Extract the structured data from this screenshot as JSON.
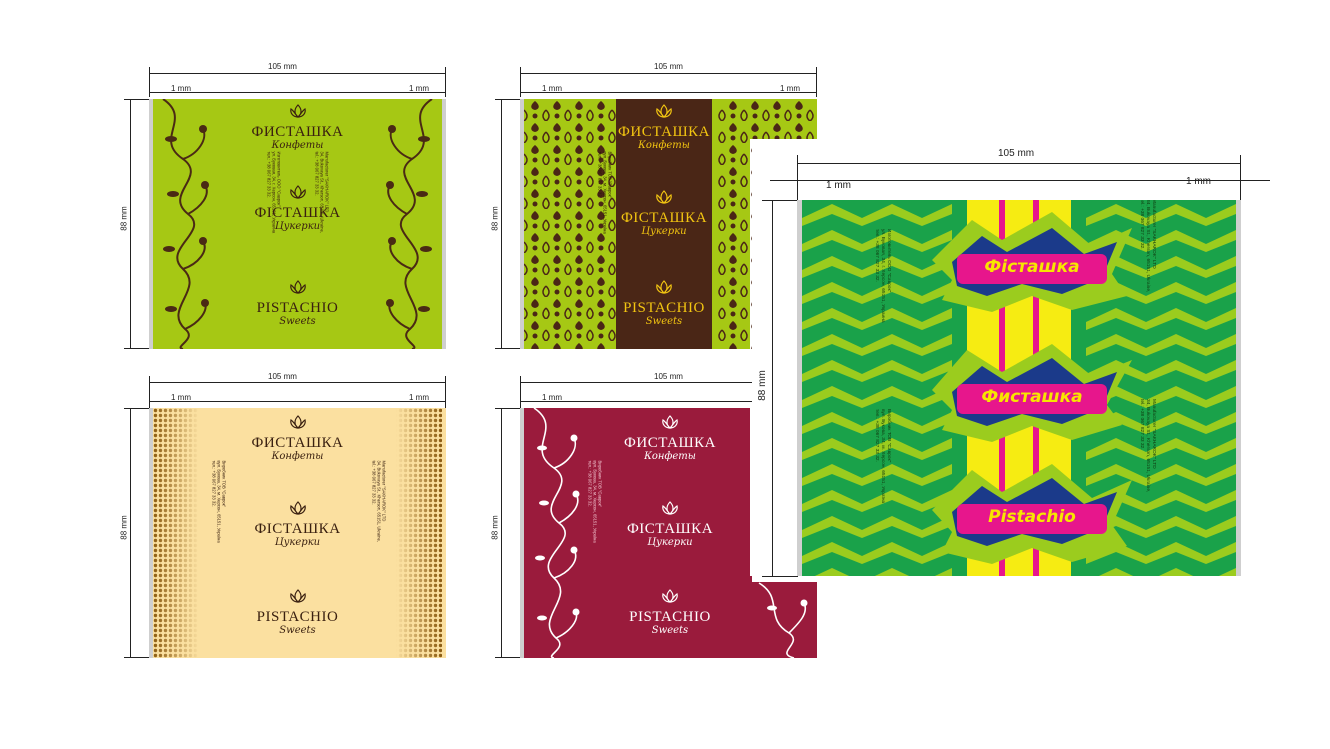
{
  "dimensions": {
    "width_label": "105 mm",
    "height_label": "88 mm",
    "margin_left_label": "1 mm",
    "margin_right_label": "1 mm"
  },
  "brand": {
    "line1_ru": "ФИСТАШКА",
    "line1_ru_sub": "Конфеты",
    "line2_ua": "ФІСТАШКА",
    "line2_ua_sub": "Цукерки",
    "line3_en": "PISTACHIO",
    "line3_en_sub": "Sweets"
  },
  "producer": {
    "ua_1": "Виробник ТОВ \"Саврок\"",
    "ua_2": "вул. Букова, 34, м. Херсон, 65151, Україна",
    "ua_3": "тел.: +38 067 827 33 32.",
    "ru_1": "Изготовитель ООО \"Саврок\"",
    "ru_2": "ул. Буковая, 34, г. Херсон, 65151, Украина",
    "ru_3": "тел.: +38 067 827 33 32.",
    "en_1": "Manufacturer \"SAKHAROK\" LTD",
    "en_2": "34, Bukovaya St., Kherson, 65151, Ukraine,",
    "en_3": "tel.: +38 067 827 33 32."
  },
  "kids_wrapper": {
    "label1": "Фісташка",
    "label2": "Фисташка",
    "label3": "Pistachio"
  },
  "colors": {
    "green_bg": "#a6c814",
    "green_ornament": "#4a2a14",
    "brown_panel": "#4a2616",
    "yellow_text": "#f2c511",
    "cream_bg": "#fbe0a0",
    "cream_dots": "#8a5a10",
    "burgundy_bg": "#9a1b3c",
    "kids_green": "#1aa24a",
    "kids_lime": "#9bcc1e",
    "kids_yellow": "#f6ec12",
    "kids_pink": "#e7168c"
  }
}
